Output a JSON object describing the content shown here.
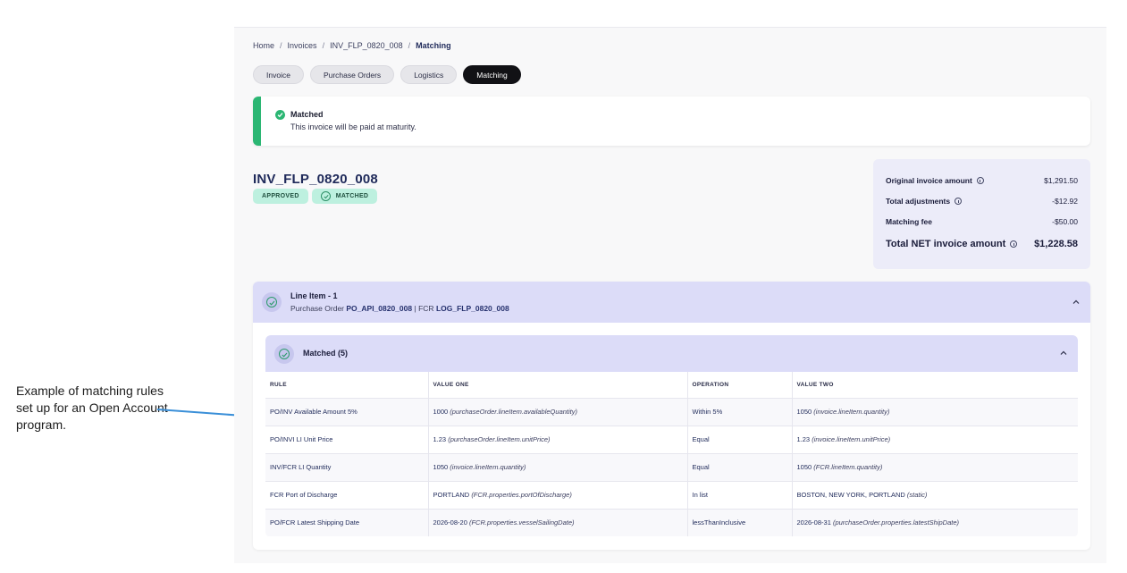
{
  "annotation": {
    "text": " Example of matching rules set up for an Open Account program."
  },
  "breadcrumb": [
    "Home",
    "Invoices",
    "INV_FLP_0820_008",
    "Matching"
  ],
  "tabs": [
    {
      "label": "Invoice",
      "active": false
    },
    {
      "label": "Purchase Orders",
      "active": false
    },
    {
      "label": "Logistics",
      "active": false
    },
    {
      "label": "Matching",
      "active": true
    }
  ],
  "banner": {
    "title": "Matched",
    "message": "This invoice will be paid at maturity.",
    "color": "#2bb673"
  },
  "invoice": {
    "id": "INV_FLP_0820_008",
    "badges": [
      "APPROVED",
      "MATCHED"
    ]
  },
  "summary": {
    "original_label": "Original invoice amount",
    "original_value": "$1,291.50",
    "adjustments_label": "Total adjustments",
    "adjustments_value": "-$12.92",
    "fee_label": "Matching fee",
    "fee_value": "-$50.00",
    "net_label": "Total NET invoice amount",
    "net_value": "$1,228.58"
  },
  "line_item": {
    "title": "Line Item - 1",
    "po_prefix": "Purchase Order",
    "po_id": "PO_API_0820_008",
    "separator": "|",
    "fcr_prefix": "FCR",
    "fcr_id": "LOG_FLP_0820_008"
  },
  "matched": {
    "title": "Matched (5)",
    "columns": [
      "RULE",
      "VALUE ONE",
      "OPERATION",
      "VALUE TWO"
    ],
    "rows": [
      {
        "rule": "PO/INV Available Amount 5%",
        "v1": "1000",
        "v1_src": "(purchaseOrder.lineItem.availableQuantity)",
        "op": "Within 5%",
        "v2": "1050",
        "v2_src": "(invoice.lineItem.quantity)"
      },
      {
        "rule": "PO/INVI LI Unit Price",
        "v1": "1.23",
        "v1_src": "(purchaseOrder.lineItem.unitPrice)",
        "op": "Equal",
        "v2": "1.23",
        "v2_src": "(invoice.lineItem.unitPrice)"
      },
      {
        "rule": "INV/FCR LI Quantity",
        "v1": "1050",
        "v1_src": "(invoice.lineItem.quantity)",
        "op": "Equal",
        "v2": "1050",
        "v2_src": "(FCR.lineItem.quantity)"
      },
      {
        "rule": "FCR Port of Discharge",
        "v1": "PORTLAND",
        "v1_src": "(FCR.properties.portOfDischarge)",
        "op": "In list",
        "v2": "BOSTON, NEW YORK, PORTLAND",
        "v2_src": "(static)"
      },
      {
        "rule": "PO/FCR Latest Shipping Date",
        "v1": "2026-08-20",
        "v1_src": "(FCR.properties.vesselSailingDate)",
        "op": "lessThanInclusive",
        "v2": "2026-08-31",
        "v2_src": "(purchaseOrder.properties.latestShipDate)"
      }
    ]
  },
  "colors": {
    "accent_dark": "#1f2a5a",
    "header_lavender": "#dcdcf8",
    "badge_mint": "#bdf0df",
    "success_green": "#2bb673",
    "annotation_arrow": "#3a8fd8"
  },
  "icons": [
    "check-circle-icon",
    "info-icon",
    "chevron-up-icon",
    "arrow-icon"
  ]
}
